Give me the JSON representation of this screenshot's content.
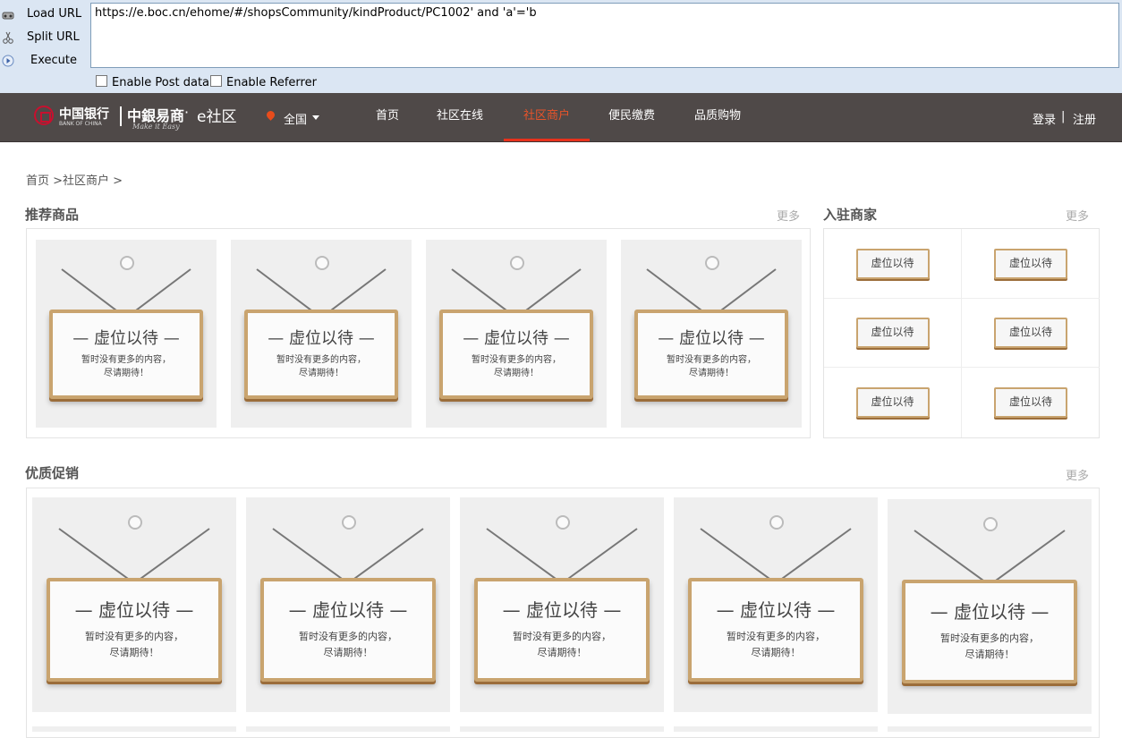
{
  "hackbar": {
    "load_url": "Load URL",
    "split_url": "Split URL",
    "execute": "Execute",
    "url_value": "https://e.boc.cn/ehome/#/shopsCommunity/kindProduct/PC1002' and 'a'='b",
    "enable_post": "Enable Post data",
    "enable_referrer": "Enable Referrer"
  },
  "header": {
    "logo_boc_cn": "中国银行",
    "logo_boc_en": "BANK OF CHINA",
    "logo_yishang": "中銀易商",
    "logo_dot": "·",
    "logo_ecommunity": "e社区",
    "logo_tagline": "Make it Easy",
    "location": "全国",
    "nav": [
      "首页",
      "社区在线",
      "社区商户",
      "便民缴费",
      "品质购物"
    ],
    "active_nav": "社区商户",
    "login": "登录",
    "divider": "|",
    "register": "注册"
  },
  "breadcrumb": "首页 >社区商户 >",
  "recommended": {
    "title": "推荐商品",
    "more": "更多",
    "placeholder_title": "— 虚位以待 —",
    "placeholder_line1": "暂时没有更多的内容，",
    "placeholder_line2": "尽请期待！"
  },
  "merchants": {
    "title": "入驻商家",
    "more": "更多",
    "placeholder": "虚位以待"
  },
  "promotions": {
    "title": "优质促销",
    "more": "更多",
    "placeholder_title": "— 虚位以待 —",
    "placeholder_line1": "暂时没有更多的内容，",
    "placeholder_line2": "尽请期待！"
  },
  "colors": {
    "nav_bg": "#4f4948",
    "nav_active": "#e8542a",
    "hackbar_bg": "#dbe6f3",
    "board_wood": "#c9a46f"
  }
}
